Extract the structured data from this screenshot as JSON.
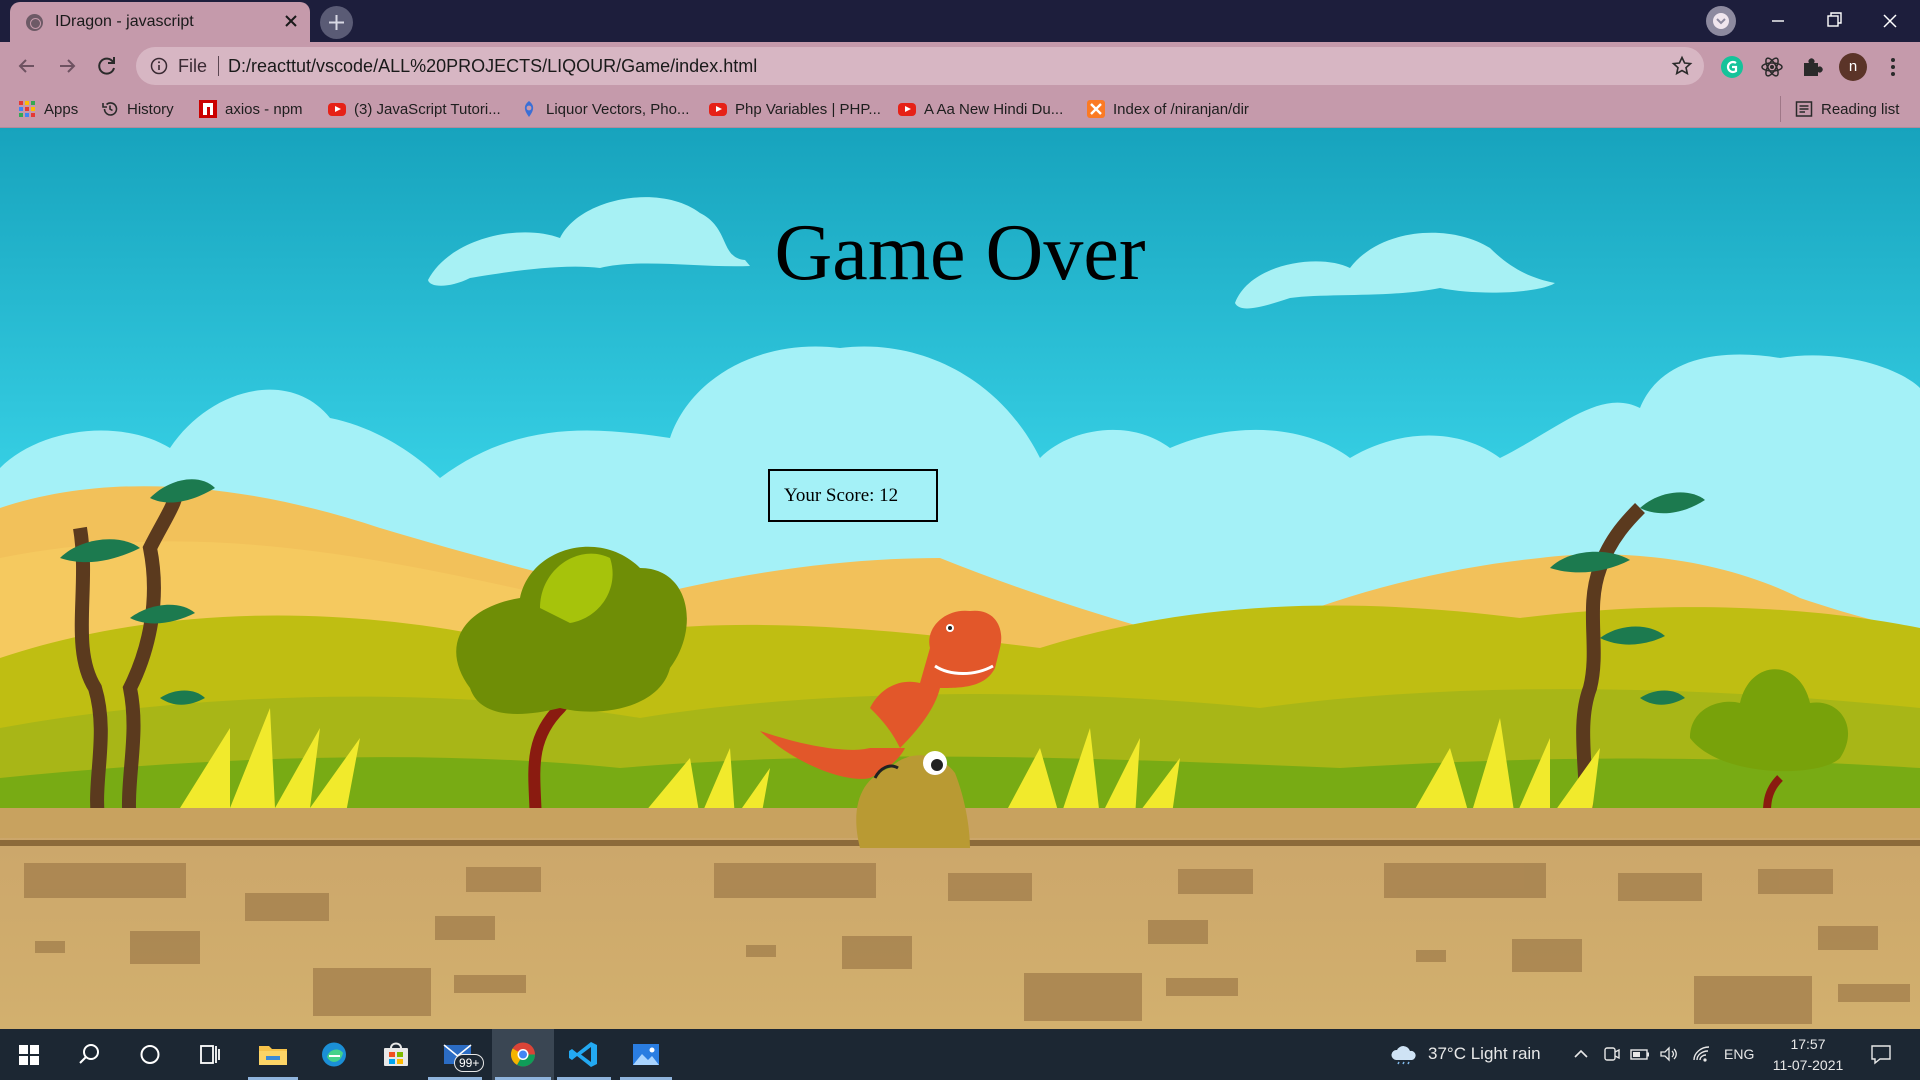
{
  "browser": {
    "tab_title": "IDragon - javascript",
    "url_scheme_label": "File",
    "url": "D:/reacttut/vscode/ALL%20PROJECTS/LIQOUR/Game/index.html",
    "profile_initial": "n",
    "reading_list_label": "Reading list",
    "bookmarks": [
      {
        "label": "Apps",
        "icon": "apps-grid-icon"
      },
      {
        "label": "History",
        "icon": "history-icon"
      },
      {
        "label": "axios - npm",
        "icon": "npm-icon"
      },
      {
        "label": "(3) JavaScript Tutori...",
        "icon": "youtube-icon"
      },
      {
        "label": "Liquor Vectors, Pho...",
        "icon": "freepik-icon"
      },
      {
        "label": "Php Variables | PHP...",
        "icon": "youtube-icon"
      },
      {
        "label": "A Aa New Hindi Du...",
        "icon": "youtube-icon"
      },
      {
        "label": "Index of /niranjan/dir",
        "icon": "xampp-icon"
      }
    ]
  },
  "game": {
    "title": "Game Over",
    "score_text": "Your Score: 12"
  },
  "taskbar": {
    "weather": "37°C  Light rain",
    "language": "ENG",
    "time": "17:57",
    "date": "11-07-2021",
    "mail_badge": "99+",
    "pinned_apps": [
      "file-explorer-icon",
      "edge-icon",
      "store-icon",
      "mail-icon",
      "chrome-icon",
      "vscode-icon",
      "photos-icon"
    ]
  },
  "colors": {
    "chrome_frame": "#c59aab",
    "title_bar": "#1d1e3c",
    "sky_top": "#17a3bd",
    "sky_bottom": "#52e4f0",
    "taskbar": "#1c2733"
  }
}
